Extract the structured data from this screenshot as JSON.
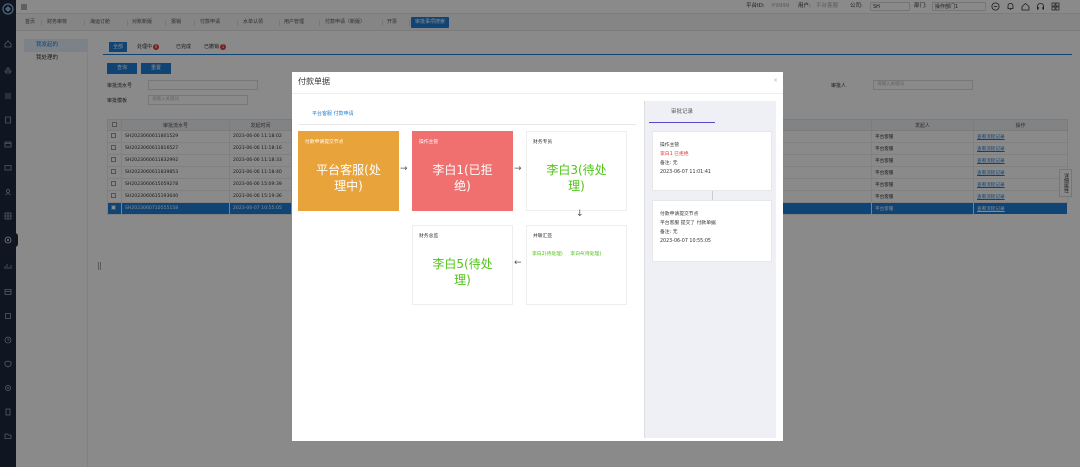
{
  "header": {
    "platform_id_label": "平台ID:",
    "platform_id": "P9999",
    "user_label": "用户:",
    "user_value": "平台客服",
    "company_label": "公司:",
    "company_value": "SH",
    "dept_label": "部门:",
    "dept_value": "操作部门1"
  },
  "tabs": [
    {
      "label": "首页",
      "active": false
    },
    {
      "label": "财务审核",
      "active": false
    },
    {
      "label": "海运订舱",
      "active": false
    },
    {
      "label": "对账新版",
      "active": false
    },
    {
      "label": "报销",
      "active": false
    },
    {
      "label": "付款申请",
      "active": false
    },
    {
      "label": "水单认领",
      "active": false
    },
    {
      "label": "用户管理",
      "active": false
    },
    {
      "label": "付款申请（新版）",
      "active": false
    },
    {
      "label": "开票",
      "active": false
    },
    {
      "label": "审批事项搜索",
      "active": true
    }
  ],
  "sidebar": {
    "items": [
      "我发起的",
      "我处理的"
    ]
  },
  "main": {
    "subtabs": [
      {
        "label": "全部"
      },
      {
        "label": "处理中",
        "badge": "6"
      },
      {
        "label": "已完成"
      },
      {
        "label": "已撤销",
        "badge": "1"
      }
    ],
    "query_button": "查询",
    "reset_button": "重置",
    "filter_serial_label": "审批流水号",
    "filter_template_label": "审批模板",
    "filter_template_placeholder": "请输入关键词",
    "filter_approver_label": "审批人",
    "filter_approver_placeholder": "请输入关键词",
    "side_vtab": "详细属性",
    "table": {
      "headers": [
        "",
        "审批流水号",
        "发起时间",
        "",
        "",
        "发起人",
        "操作"
      ],
      "rows": [
        {
          "serial": "SH2023060611801529",
          "time": "2023-06-06 11:18:02",
          "initiator": "平台客服",
          "action": "查看流程记录"
        },
        {
          "serial": "SH2023060611816527",
          "time": "2023-06-06 11:18:16",
          "initiator": "平台客服",
          "action": "查看流程记录"
        },
        {
          "serial": "SH2023060611832992",
          "time": "2023-06-06 11:18:33",
          "initiator": "平台客服",
          "action": "查看流程记录"
        },
        {
          "serial": "SH2023060611839853",
          "time": "2023-06-06 11:18:40",
          "initiator": "平台客服",
          "action": "查看流程记录"
        },
        {
          "serial": "SH2023060615059278",
          "time": "2023-06-06 15:09:39",
          "initiator": "平台客服",
          "action": "查看流程记录"
        },
        {
          "serial": "SH2023060615193640",
          "time": "2023-06-06 15:19:36",
          "initiator": "平台客服",
          "action": "查看流程记录"
        },
        {
          "serial": "SH2023060710555158",
          "time": "2023-06-07 10:55:05",
          "initiator": "平台客服",
          "action": "查看流程记录",
          "selected": true
        }
      ]
    }
  },
  "modal": {
    "title": "付款单据",
    "close": "×",
    "breadcrumb": "平台客服 付款申请",
    "nodes": [
      {
        "header": "付款申请提交节点",
        "body": "平台客服(处理中)",
        "style": "orange"
      },
      {
        "header": "操作主管",
        "body": "李白1(已拒绝)",
        "style": "red"
      },
      {
        "header": "财务专员",
        "body": "李白3(待处理)",
        "style": "white"
      },
      {
        "header": "财务总监",
        "body": "李白5(待处理)",
        "style": "white"
      },
      {
        "header": "并联汇签",
        "subs": [
          "李白2(待处理)",
          "李白4(待处理)"
        ],
        "style": "white"
      }
    ],
    "arrows": [
      "→",
      "→",
      "↓",
      "←"
    ],
    "records_tab": "审批记录",
    "records": [
      {
        "title": "操作主管",
        "status": "李白1 已拒绝",
        "note": "备注: 无",
        "time": "2023-06-07 11:01:41"
      },
      {
        "title": "付款申请提交节点",
        "status": "平台客服 提交了 付款单据",
        "note": "备注: 无",
        "time": "2023-06-07 10:55:05"
      }
    ]
  },
  "colors": {
    "accent": "#1e7fd7",
    "node_orange": "#e8a33a",
    "node_red": "#f07070",
    "pending_green": "#52c41a",
    "rejected_red": "#e4393c"
  }
}
